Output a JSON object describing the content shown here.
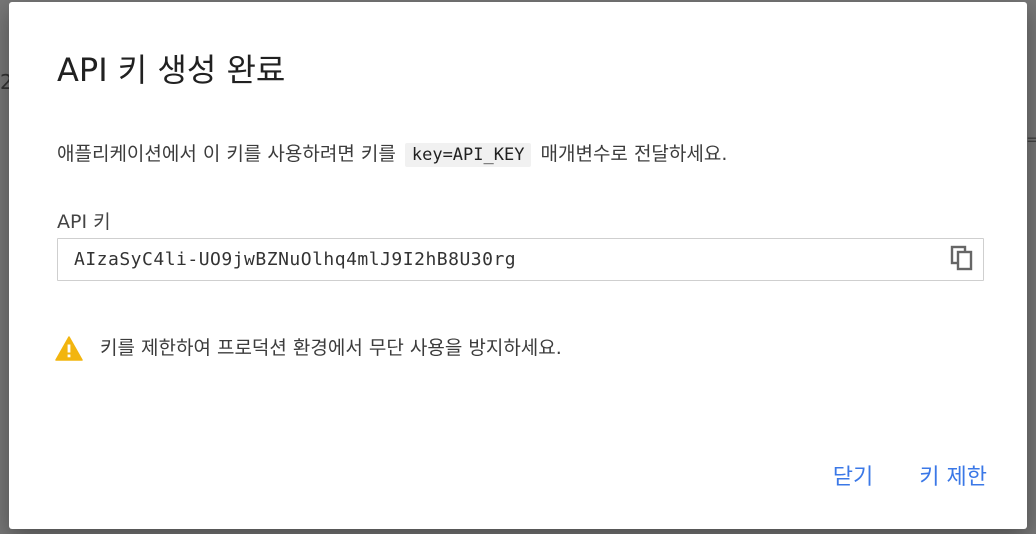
{
  "background": {
    "left_fragment": "2",
    "right_fragment": "="
  },
  "dialog": {
    "title": "API 키 생성 완료",
    "description": {
      "before": "애플리케이션에서 이 키를 사용하려면 키를",
      "code": "key=API_KEY",
      "after": "매개변수로 전달하세요."
    },
    "field_label": "API 키",
    "api_key": "AIzaSyC4li-UO9jwBZNuOlhq4mlJ9I2hB8U30rg",
    "copy_icon": "copy-icon",
    "warning_icon": "warning-icon",
    "warning_text": "키를 제한하여 프로덕션 환경에서 무단 사용을 방지하세요.",
    "buttons": {
      "close_label": "닫기",
      "restrict_label": "키 제한"
    },
    "colors": {
      "accent": "#3b78e7",
      "warning": "#f2b50f"
    }
  }
}
